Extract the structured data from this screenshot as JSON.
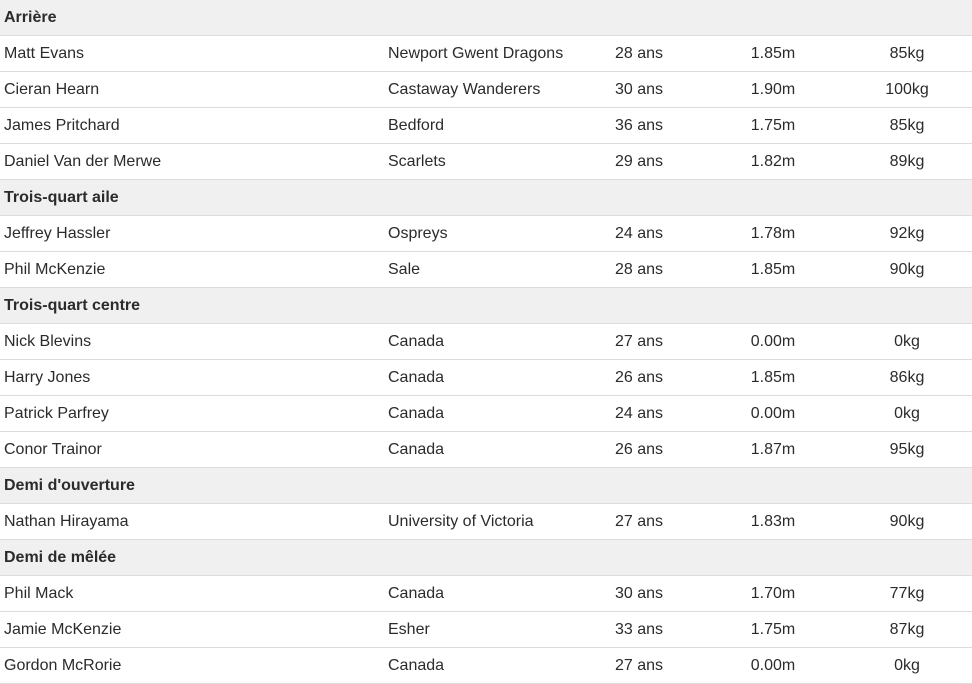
{
  "groups": [
    {
      "title": "Arrière",
      "players": [
        {
          "name": "Matt Evans",
          "club": "Newport Gwent Dragons",
          "age": "28 ans",
          "height": "1.85m",
          "weight": "85kg"
        },
        {
          "name": "Cieran Hearn",
          "club": "Castaway Wanderers",
          "age": "30 ans",
          "height": "1.90m",
          "weight": "100kg"
        },
        {
          "name": "James Pritchard",
          "club": "Bedford",
          "age": "36 ans",
          "height": "1.75m",
          "weight": "85kg"
        },
        {
          "name": "Daniel Van der Merwe",
          "club": "Scarlets",
          "age": "29 ans",
          "height": "1.82m",
          "weight": "89kg"
        }
      ]
    },
    {
      "title": "Trois-quart aile",
      "players": [
        {
          "name": "Jeffrey Hassler",
          "club": "Ospreys",
          "age": "24 ans",
          "height": "1.78m",
          "weight": "92kg"
        },
        {
          "name": "Phil McKenzie",
          "club": "Sale",
          "age": "28 ans",
          "height": "1.85m",
          "weight": "90kg"
        }
      ]
    },
    {
      "title": "Trois-quart centre",
      "players": [
        {
          "name": "Nick Blevins",
          "club": "Canada",
          "age": "27 ans",
          "height": "0.00m",
          "weight": "0kg"
        },
        {
          "name": "Harry Jones",
          "club": "Canada",
          "age": "26 ans",
          "height": "1.85m",
          "weight": "86kg"
        },
        {
          "name": "Patrick Parfrey",
          "club": "Canada",
          "age": "24 ans",
          "height": "0.00m",
          "weight": "0kg"
        },
        {
          "name": "Conor Trainor",
          "club": "Canada",
          "age": "26 ans",
          "height": "1.87m",
          "weight": "95kg"
        }
      ]
    },
    {
      "title": "Demi d'ouverture",
      "players": [
        {
          "name": "Nathan Hirayama",
          "club": "University of Victoria",
          "age": "27 ans",
          "height": "1.83m",
          "weight": "90kg"
        }
      ]
    },
    {
      "title": "Demi de mêlée",
      "players": [
        {
          "name": "Phil Mack",
          "club": "Canada",
          "age": "30 ans",
          "height": "1.70m",
          "weight": "77kg"
        },
        {
          "name": "Jamie McKenzie",
          "club": "Esher",
          "age": "33 ans",
          "height": "1.75m",
          "weight": "87kg"
        },
        {
          "name": "Gordon McRorie",
          "club": "Canada",
          "age": "27 ans",
          "height": "0.00m",
          "weight": "0kg"
        }
      ]
    }
  ]
}
